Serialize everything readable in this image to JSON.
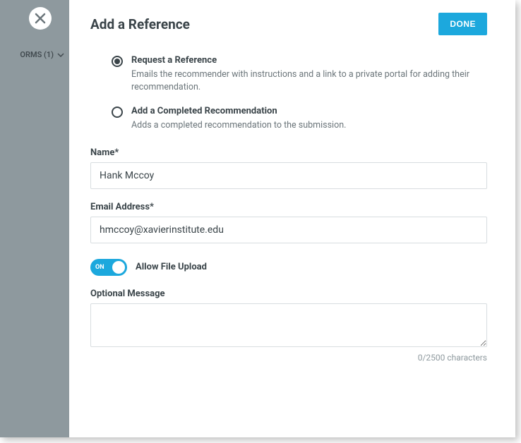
{
  "sidebar": {
    "forms_label": "ORMS (1)"
  },
  "header": {
    "title": "Add a Reference",
    "done_label": "DONE"
  },
  "options": {
    "request": {
      "label": "Request a Reference",
      "description": "Emails the recommender with instructions and a link to a private portal for adding their recommendation."
    },
    "completed": {
      "label": "Add a Completed Recommendation",
      "description": "Adds a completed recommendation to the submission."
    }
  },
  "fields": {
    "name": {
      "label": "Name*",
      "value": "Hank Mccoy"
    },
    "email": {
      "label": "Email Address*",
      "value": "hmccoy@xavierinstitute.edu"
    },
    "upload": {
      "toggle_text": "ON",
      "label": "Allow File Upload"
    },
    "message": {
      "label": "Optional Message",
      "value": "",
      "counter": "0/2500 characters"
    }
  }
}
